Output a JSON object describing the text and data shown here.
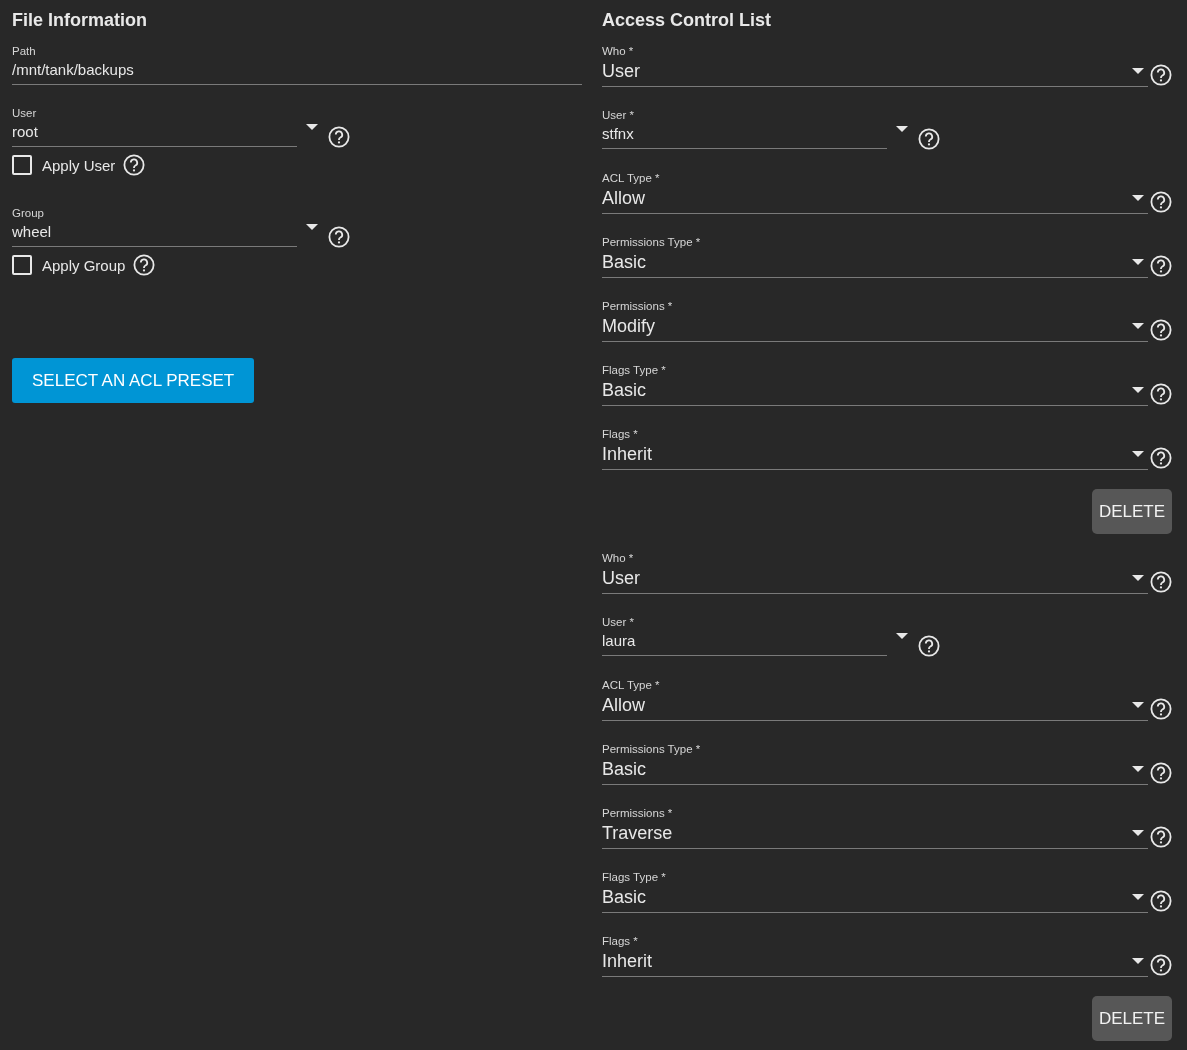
{
  "file_information": {
    "title": "File Information",
    "fields": [
      {
        "kind": "text",
        "label": "Path",
        "value": "/mnt/tank/backups"
      },
      {
        "kind": "combobox",
        "label": "User",
        "value": "root",
        "checkbox": {
          "label": "Apply User",
          "checked": false
        }
      },
      {
        "kind": "combobox",
        "label": "Group",
        "value": "wheel",
        "checkbox": {
          "label": "Apply Group",
          "checked": false
        }
      }
    ],
    "preset_button": "SELECT AN ACL PRESET"
  },
  "access_control_list": {
    "title": "Access Control List",
    "entries": [
      {
        "fields": [
          {
            "kind": "select",
            "label": "Who *",
            "value": "User"
          },
          {
            "kind": "combobox",
            "label": "User *",
            "value": "stfnx"
          },
          {
            "kind": "select",
            "label": "ACL Type *",
            "value": "Allow"
          },
          {
            "kind": "select",
            "label": "Permissions Type *",
            "value": "Basic"
          },
          {
            "kind": "select",
            "label": "Permissions *",
            "value": "Modify"
          },
          {
            "kind": "select",
            "label": "Flags Type *",
            "value": "Basic"
          },
          {
            "kind": "select",
            "label": "Flags *",
            "value": "Inherit"
          }
        ],
        "delete_button": "DELETE"
      },
      {
        "fields": [
          {
            "kind": "select",
            "label": "Who *",
            "value": "User"
          },
          {
            "kind": "combobox",
            "label": "User *",
            "value": "laura"
          },
          {
            "kind": "select",
            "label": "ACL Type *",
            "value": "Allow"
          },
          {
            "kind": "select",
            "label": "Permissions Type *",
            "value": "Basic"
          },
          {
            "kind": "select",
            "label": "Permissions *",
            "value": "Traverse"
          },
          {
            "kind": "select",
            "label": "Flags Type *",
            "value": "Basic"
          },
          {
            "kind": "select",
            "label": "Flags *",
            "value": "Inherit"
          }
        ],
        "delete_button": "DELETE"
      }
    ]
  }
}
